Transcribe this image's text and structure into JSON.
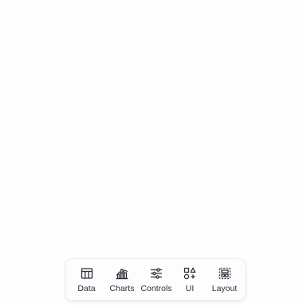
{
  "toolbar": {
    "items": [
      {
        "label": "Data",
        "icon": "table-icon"
      },
      {
        "label": "Charts",
        "icon": "bar-chart-icon"
      },
      {
        "label": "Controls",
        "icon": "sliders-icon"
      },
      {
        "label": "UI",
        "icon": "shapes-icon"
      },
      {
        "label": "Layout",
        "icon": "layout-icon"
      }
    ]
  },
  "colors": {
    "background": "#fefefe",
    "icon": "#2b2f3a",
    "text": "#2b2f3a",
    "border": "#eef0f3"
  }
}
